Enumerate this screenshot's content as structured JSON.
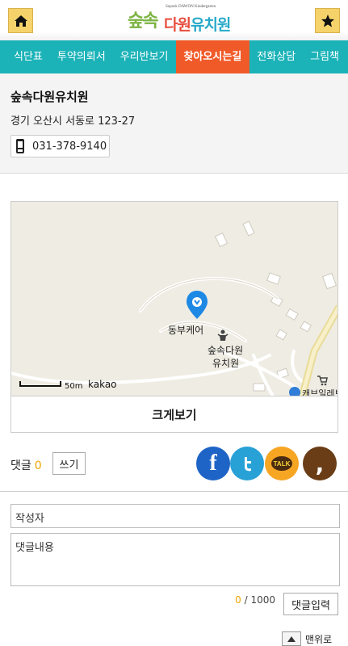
{
  "header": {
    "home_icon": "home-icon",
    "favorite_icon": "star-icon",
    "logo": {
      "small_text": "Soposk DAWON Kindergarten",
      "part1": "숲속",
      "part2a": "다원",
      "part2b": "유치원"
    }
  },
  "nav": {
    "items": [
      "식단표",
      "투약의뢰서",
      "우리반보기",
      "찾아오시는길",
      "전화상담",
      "그림책"
    ],
    "active_index": 3
  },
  "info": {
    "name": "숲속다원유치원",
    "address": "경기 오산시 서동로 123-27",
    "phone_icon": "phone-icon",
    "phone": "031-378-9140"
  },
  "map": {
    "marker_label": "동부케어",
    "place_label_1": "숲속다원",
    "place_label_2": "유치원",
    "scale": "50m",
    "provider": "kakao",
    "cut_label": "캐브일레브"
  },
  "big_view_label": "크게보기",
  "comments": {
    "label": "댓글",
    "count": "0",
    "write_label": "쓰기",
    "share": {
      "facebook": "f",
      "twitter": "t",
      "kakaotalk": "TALK",
      "kakaostory": ","
    }
  },
  "form": {
    "author_placeholder": "작성자",
    "content_placeholder": "댓글내용",
    "char_current": "0",
    "char_max": " / 1000",
    "submit_label": "댓글입력"
  },
  "to_top_label": "맨위로",
  "colors": {
    "nav_bg": "#1cb3b8",
    "nav_active": "#f05a28",
    "header_button": "#f5d36a",
    "count_accent": "#f0a500"
  }
}
